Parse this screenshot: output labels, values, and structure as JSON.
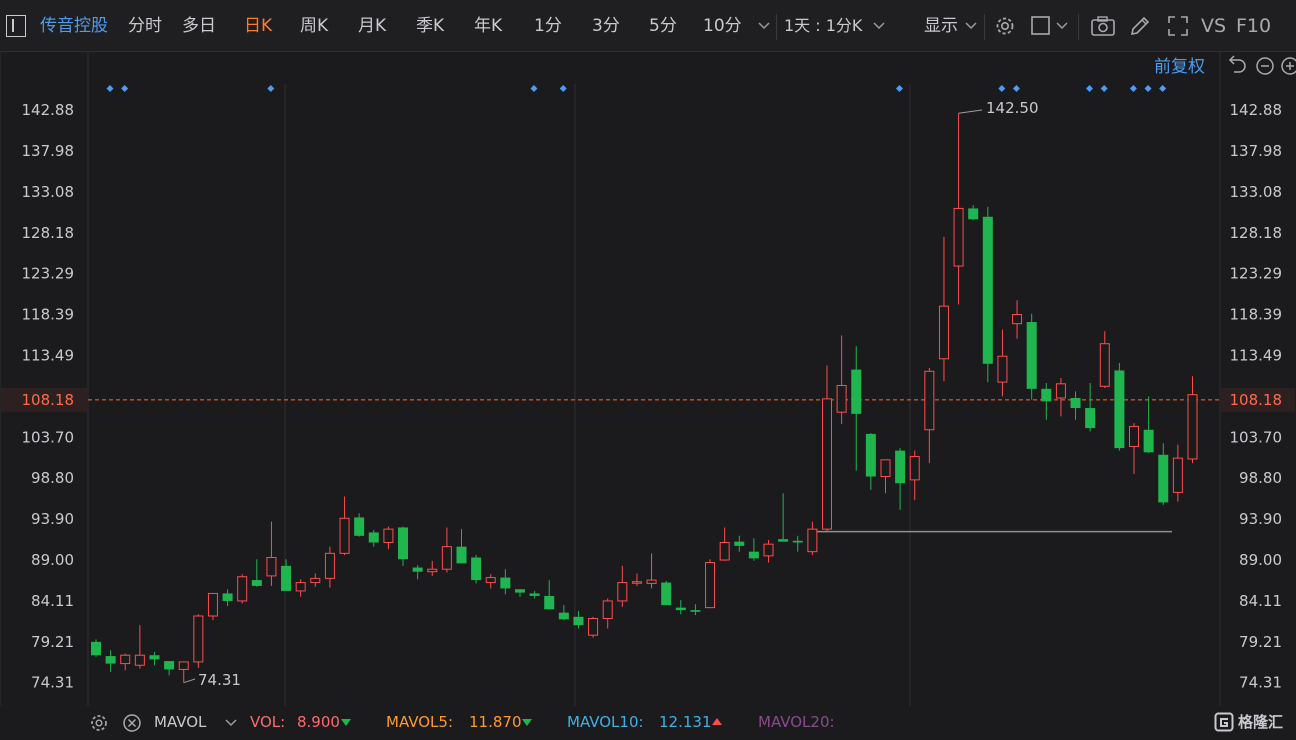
{
  "toolbar": {
    "stock_name": "传音控股",
    "periods": [
      "分时",
      "多日",
      "日K",
      "周K",
      "月K",
      "季K",
      "年K",
      "1分",
      "3分",
      "5分",
      "10分"
    ],
    "active_period": "日K",
    "interval_select": "1天 : 1分K",
    "display_label": "显示",
    "vs_label": "VS",
    "f10_label": "F10"
  },
  "adjust_label": "前复权",
  "colors": {
    "up": "#ff4d4d",
    "down": "#1fb650",
    "accent": "#ff7a2f",
    "blue": "#4e9bf0",
    "background": "#1b1b1d"
  },
  "chart_data": {
    "type": "candlestick",
    "yticks": [
      142.88,
      137.98,
      133.08,
      128.18,
      123.29,
      118.39,
      113.49,
      108.18,
      103.7,
      98.8,
      93.9,
      89.0,
      84.11,
      79.21,
      74.31
    ],
    "ylim": [
      72.0,
      146.0
    ],
    "current_price": 108.18,
    "high_label": "142.50",
    "high_value": 142.5,
    "low_label": "74.31",
    "low_value": 74.31,
    "support_level": 92.4,
    "candles": [
      [
        79.2,
        79.5,
        77.4,
        77.6
      ],
      [
        77.5,
        78.2,
        75.6,
        76.6
      ],
      [
        76.6,
        77.8,
        75.8,
        77.6
      ],
      [
        76.4,
        81.2,
        76.0,
        77.6
      ],
      [
        77.6,
        78.0,
        76.4,
        77.1
      ],
      [
        76.9,
        76.4,
        75.2,
        75.9
      ],
      [
        75.9,
        76.3,
        74.3,
        76.8
      ],
      [
        76.8,
        82.5,
        76.1,
        82.3
      ],
      [
        82.3,
        85.0,
        81.8,
        85.0
      ],
      [
        85.0,
        85.5,
        83.5,
        84.1
      ],
      [
        84.1,
        87.3,
        83.8,
        87.0
      ],
      [
        86.6,
        89.1,
        85.8,
        85.9
      ],
      [
        87.1,
        93.6,
        85.9,
        89.3
      ],
      [
        88.3,
        89.1,
        85.9,
        85.3
      ],
      [
        85.3,
        86.7,
        84.6,
        86.3
      ],
      [
        86.3,
        87.4,
        85.8,
        86.8
      ],
      [
        86.8,
        90.6,
        85.7,
        89.8
      ],
      [
        89.8,
        96.6,
        89.6,
        94.0
      ],
      [
        94.1,
        94.6,
        91.8,
        91.9
      ],
      [
        92.3,
        92.6,
        90.6,
        91.1
      ],
      [
        91.1,
        93.0,
        90.3,
        92.7
      ],
      [
        92.9,
        93.0,
        88.3,
        89.1
      ],
      [
        88.1,
        88.4,
        86.7,
        87.6
      ],
      [
        87.6,
        88.9,
        87.1,
        87.9
      ],
      [
        87.9,
        92.9,
        87.5,
        90.6
      ],
      [
        90.6,
        92.7,
        88.6,
        88.6
      ],
      [
        89.3,
        89.6,
        86.2,
        86.6
      ],
      [
        86.3,
        87.3,
        85.6,
        86.9
      ],
      [
        86.9,
        87.9,
        84.9,
        85.6
      ],
      [
        85.5,
        85.5,
        84.6,
        85.1
      ],
      [
        85.0,
        85.3,
        84.4,
        84.7
      ],
      [
        84.7,
        86.6,
        83.1,
        83.1
      ],
      [
        82.7,
        83.6,
        81.8,
        81.9
      ],
      [
        82.2,
        82.9,
        80.8,
        81.2
      ],
      [
        80.0,
        82.2,
        79.7,
        82.0
      ],
      [
        82.0,
        84.4,
        80.8,
        84.1
      ],
      [
        84.1,
        88.3,
        83.4,
        86.3
      ],
      [
        86.3,
        87.4,
        85.9,
        86.4
      ],
      [
        86.2,
        89.8,
        85.6,
        86.6
      ],
      [
        86.3,
        86.5,
        84.6,
        83.6
      ],
      [
        83.3,
        84.2,
        82.5,
        83.0
      ],
      [
        83.0,
        83.7,
        82.4,
        82.8
      ],
      [
        83.3,
        89.1,
        83.3,
        88.7
      ],
      [
        89.0,
        92.9,
        88.9,
        91.1
      ],
      [
        91.2,
        91.9,
        90.0,
        90.7
      ],
      [
        90.0,
        91.6,
        88.9,
        89.2
      ],
      [
        89.5,
        91.4,
        88.7,
        90.9
      ],
      [
        91.5,
        97.0,
        91.2,
        91.2
      ],
      [
        91.3,
        91.9,
        90.0,
        91.1
      ],
      [
        90.0,
        93.6,
        89.6,
        92.7
      ],
      [
        92.7,
        112.3,
        92.4,
        108.3
      ],
      [
        106.7,
        115.9,
        105.3,
        109.9
      ],
      [
        111.8,
        114.6,
        99.7,
        106.5
      ],
      [
        104.1,
        104.2,
        97.4,
        99.0
      ],
      [
        99.0,
        101.0,
        97.0,
        101.0
      ],
      [
        102.1,
        102.4,
        95.0,
        98.2
      ],
      [
        98.6,
        102.1,
        96.2,
        101.4
      ],
      [
        104.6,
        112.0,
        100.6,
        111.6
      ],
      [
        113.1,
        127.7,
        110.4,
        119.4
      ],
      [
        124.2,
        142.5,
        119.6,
        131.1
      ],
      [
        131.1,
        131.5,
        129.7,
        129.8
      ],
      [
        130.1,
        131.3,
        110.3,
        112.5
      ],
      [
        110.3,
        116.6,
        108.6,
        113.4
      ],
      [
        117.3,
        120.1,
        115.5,
        118.4
      ],
      [
        117.5,
        118.5,
        108.2,
        109.5
      ],
      [
        109.5,
        110.2,
        105.8,
        108.0
      ],
      [
        108.4,
        110.8,
        106.2,
        110.1
      ],
      [
        108.4,
        109.2,
        105.8,
        107.2
      ],
      [
        107.2,
        110.2,
        104.4,
        104.8
      ],
      [
        109.8,
        116.4,
        109.6,
        114.9
      ],
      [
        111.7,
        112.6,
        102.1,
        102.4
      ],
      [
        102.6,
        105.4,
        99.3,
        105.0
      ],
      [
        104.6,
        108.6,
        101.8,
        101.9
      ],
      [
        101.6,
        103.0,
        95.6,
        95.9
      ],
      [
        97.1,
        102.8,
        96.0,
        101.2
      ],
      [
        101.1,
        111.0,
        100.6,
        108.8
      ]
    ],
    "event_marks": [
      0,
      1,
      11,
      29,
      31,
      54,
      61,
      62,
      67,
      68,
      70,
      71,
      72
    ]
  },
  "bottom": {
    "mavol_label": "MAVOL",
    "vol_label": "VOL:",
    "vol_value": "8.900",
    "mavol5_label": "MAVOL5:",
    "mavol5_value": "11.870",
    "mavol10_label": "MAVOL10:",
    "mavol10_value": "12.131",
    "mavol20_label": "MAVOL20:",
    "brand": "格隆汇"
  }
}
